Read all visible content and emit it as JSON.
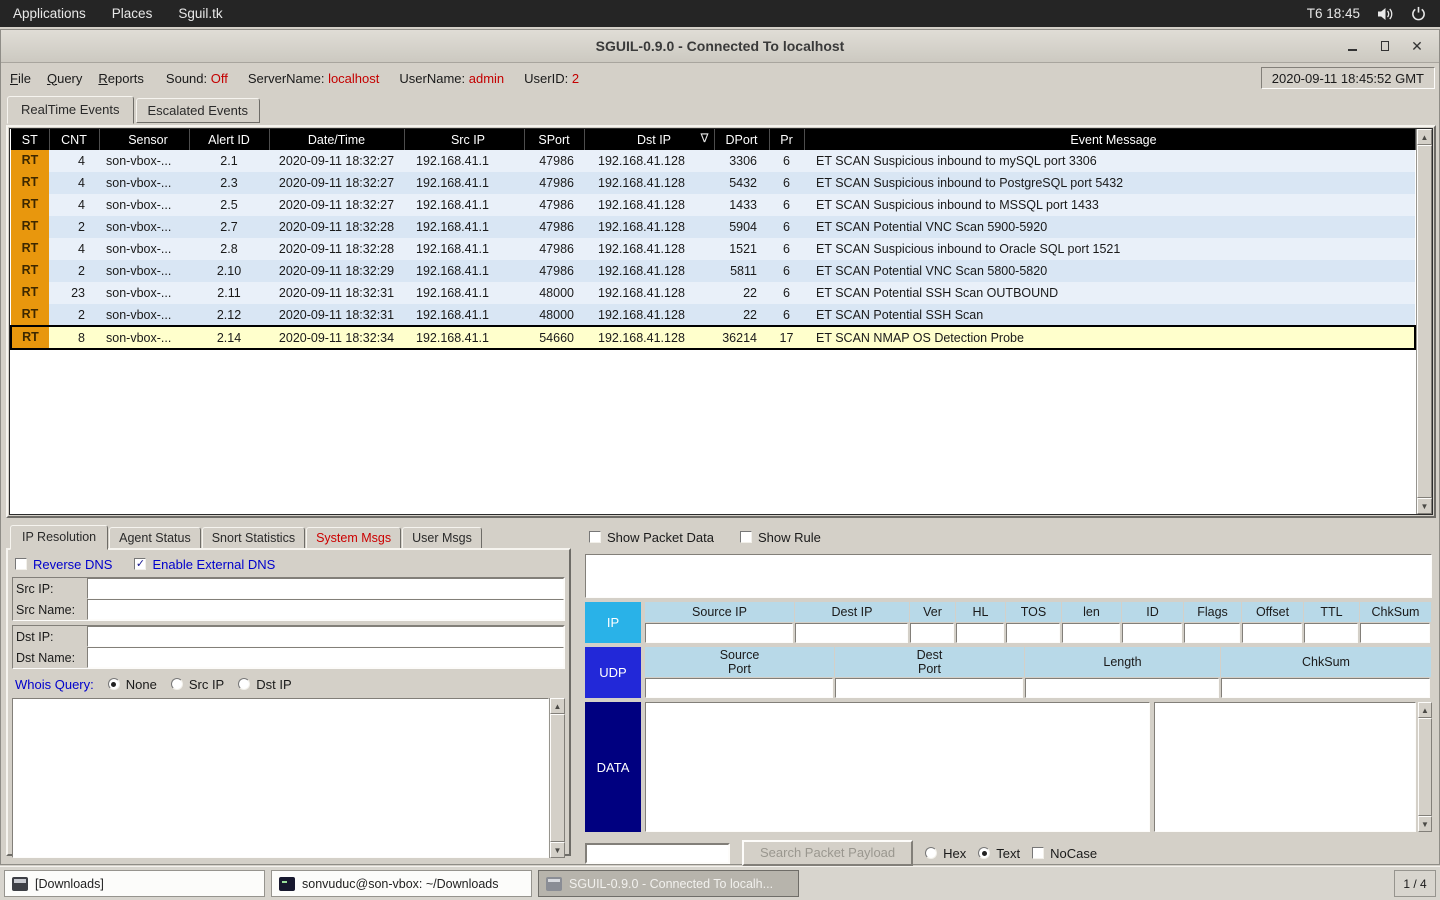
{
  "colors": {
    "rt_badge": "#E8970D",
    "selected_row": "#FFFFCC",
    "row_light": "#E9F0F9",
    "row_dark": "#D9E6F4",
    "alert_red": "#CC0000",
    "label_blue": "#0000CC",
    "ip_header_cyan": "#29B2E8",
    "udp_header_blue": "#2228D8",
    "data_header_navy": "#000080",
    "table_header": "#000000"
  },
  "icons": {
    "sort": "∇",
    "arrow_up": "▲",
    "arrow_down": "▼",
    "close": "✕",
    "check": "✓"
  },
  "topbar": {
    "menus": [
      "Applications",
      "Places",
      "Sguil.tk"
    ],
    "clock": "T6 18:45"
  },
  "window": {
    "title": "SGUIL-0.9.0 - Connected To localhost",
    "menus": [
      "File",
      "Query",
      "Reports"
    ],
    "status": {
      "sound_label": "Sound:",
      "sound_value": "Off",
      "server_label": "ServerName:",
      "server_value": "localhost",
      "user_label": "UserName:",
      "user_value": "admin",
      "userid_label": "UserID:",
      "userid_value": "2"
    },
    "clock": "2020-09-11 18:45:52 GMT",
    "tabs": [
      "RealTime Events",
      "Escalated Events"
    ]
  },
  "events": {
    "columns": [
      "ST",
      "CNT",
      "Sensor",
      "Alert ID",
      "Date/Time",
      "Src IP",
      "SPort",
      "Dst IP",
      "DPort",
      "Pr",
      "Event Message"
    ],
    "rows": [
      {
        "st": "RT",
        "cnt": "4",
        "sensor": "son-vbox-...",
        "alert_id": "2.1",
        "datetime": "2020-09-11 18:32:27",
        "src_ip": "192.168.41.1",
        "sport": "47986",
        "dst_ip": "192.168.41.128",
        "dport": "3306",
        "pr": "6",
        "message": "ET SCAN Suspicious inbound to mySQL port 3306"
      },
      {
        "st": "RT",
        "cnt": "4",
        "sensor": "son-vbox-...",
        "alert_id": "2.3",
        "datetime": "2020-09-11 18:32:27",
        "src_ip": "192.168.41.1",
        "sport": "47986",
        "dst_ip": "192.168.41.128",
        "dport": "5432",
        "pr": "6",
        "message": "ET SCAN Suspicious inbound to PostgreSQL port 5432"
      },
      {
        "st": "RT",
        "cnt": "4",
        "sensor": "son-vbox-...",
        "alert_id": "2.5",
        "datetime": "2020-09-11 18:32:27",
        "src_ip": "192.168.41.1",
        "sport": "47986",
        "dst_ip": "192.168.41.128",
        "dport": "1433",
        "pr": "6",
        "message": "ET SCAN Suspicious inbound to MSSQL port 1433"
      },
      {
        "st": "RT",
        "cnt": "2",
        "sensor": "son-vbox-...",
        "alert_id": "2.7",
        "datetime": "2020-09-11 18:32:28",
        "src_ip": "192.168.41.1",
        "sport": "47986",
        "dst_ip": "192.168.41.128",
        "dport": "5904",
        "pr": "6",
        "message": "ET SCAN Potential VNC Scan 5900-5920"
      },
      {
        "st": "RT",
        "cnt": "4",
        "sensor": "son-vbox-...",
        "alert_id": "2.8",
        "datetime": "2020-09-11 18:32:28",
        "src_ip": "192.168.41.1",
        "sport": "47986",
        "dst_ip": "192.168.41.128",
        "dport": "1521",
        "pr": "6",
        "message": "ET SCAN Suspicious inbound to Oracle SQL port 1521"
      },
      {
        "st": "RT",
        "cnt": "2",
        "sensor": "son-vbox-...",
        "alert_id": "2.10",
        "datetime": "2020-09-11 18:32:29",
        "src_ip": "192.168.41.1",
        "sport": "47986",
        "dst_ip": "192.168.41.128",
        "dport": "5811",
        "pr": "6",
        "message": "ET SCAN Potential VNC Scan 5800-5820"
      },
      {
        "st": "RT",
        "cnt": "23",
        "sensor": "son-vbox-...",
        "alert_id": "2.11",
        "datetime": "2020-09-11 18:32:31",
        "src_ip": "192.168.41.1",
        "sport": "48000",
        "dst_ip": "192.168.41.128",
        "dport": "22",
        "pr": "6",
        "message": "ET SCAN Potential SSH Scan OUTBOUND"
      },
      {
        "st": "RT",
        "cnt": "2",
        "sensor": "son-vbox-...",
        "alert_id": "2.12",
        "datetime": "2020-09-11 18:32:31",
        "src_ip": "192.168.41.1",
        "sport": "48000",
        "dst_ip": "192.168.41.128",
        "dport": "22",
        "pr": "6",
        "message": "ET SCAN Potential SSH Scan"
      },
      {
        "st": "RT",
        "cnt": "8",
        "sensor": "son-vbox-...",
        "alert_id": "2.14",
        "datetime": "2020-09-11 18:32:34",
        "src_ip": "192.168.41.1",
        "sport": "54660",
        "dst_ip": "192.168.41.128",
        "dport": "36214",
        "pr": "17",
        "message": "ET SCAN NMAP OS Detection Probe",
        "selected": true
      }
    ]
  },
  "resolution": {
    "tabs": [
      "IP Resolution",
      "Agent Status",
      "Snort Statistics",
      "System Msgs",
      "User Msgs"
    ],
    "reverse_dns": "Reverse DNS",
    "reverse_dns_checked": false,
    "external_dns": "Enable External DNS",
    "external_dns_checked": true,
    "src_ip_label": "Src IP:",
    "src_name_label": "Src Name:",
    "dst_ip_label": "Dst IP:",
    "dst_name_label": "Dst Name:",
    "whois_label": "Whois Query:",
    "whois_options": [
      "None",
      "Src IP",
      "Dst IP"
    ],
    "whois_selected": "None"
  },
  "packet": {
    "show_packet_data": "Show Packet Data",
    "show_packet_data_checked": false,
    "show_rule": "Show Rule",
    "show_rule_checked": false,
    "ip_label": "IP",
    "ip_columns": [
      "Source IP",
      "Dest IP",
      "Ver",
      "HL",
      "TOS",
      "len",
      "ID",
      "Flags",
      "Offset",
      "TTL",
      "ChkSum"
    ],
    "udp_label": "UDP",
    "udp_columns": [
      "Source\nPort",
      "Dest\nPort",
      "Length",
      "ChkSum"
    ],
    "data_label": "DATA",
    "search_button": "Search Packet Payload",
    "search_value": "",
    "hex_label": "Hex",
    "text_label": "Text",
    "text_selected": true,
    "nocase_label": "NoCase",
    "nocase_checked": false
  },
  "taskbar": {
    "windows": [
      {
        "label": "[Downloads]"
      },
      {
        "label": "sonvuduc@son-vbox: ~/Downloads"
      },
      {
        "label": "SGUIL-0.9.0 - Connected To localh...",
        "active": true
      }
    ],
    "pager": "1 / 4"
  }
}
